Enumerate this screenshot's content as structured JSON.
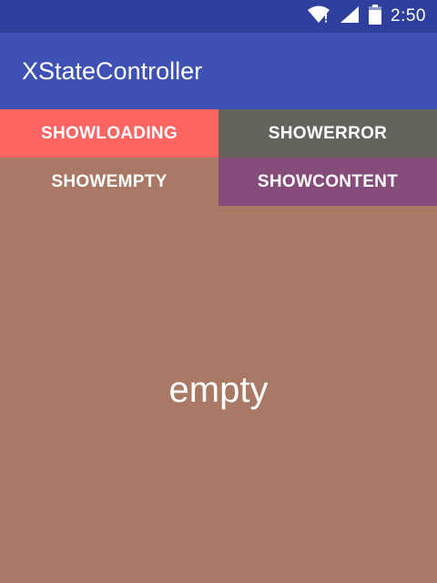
{
  "status_bar": {
    "time": "2:50",
    "icons": [
      "wifi-icon",
      "signal-icon",
      "battery-icon"
    ],
    "color": "#2F3F9E"
  },
  "app_bar": {
    "title": "XStateController",
    "color": "#3F51B5"
  },
  "buttons": {
    "show_loading": {
      "label": "SHOWLOADING",
      "color": "#FE6461"
    },
    "show_error": {
      "label": "SHOWERROR",
      "color": "#64645C"
    },
    "show_empty": {
      "label": "SHOWEMPTY",
      "color": "#A97965"
    },
    "show_content": {
      "label": "SHOWCONTENT",
      "color": "#854B7A"
    }
  },
  "state_view": {
    "text": "empty",
    "background": "#A97965"
  }
}
